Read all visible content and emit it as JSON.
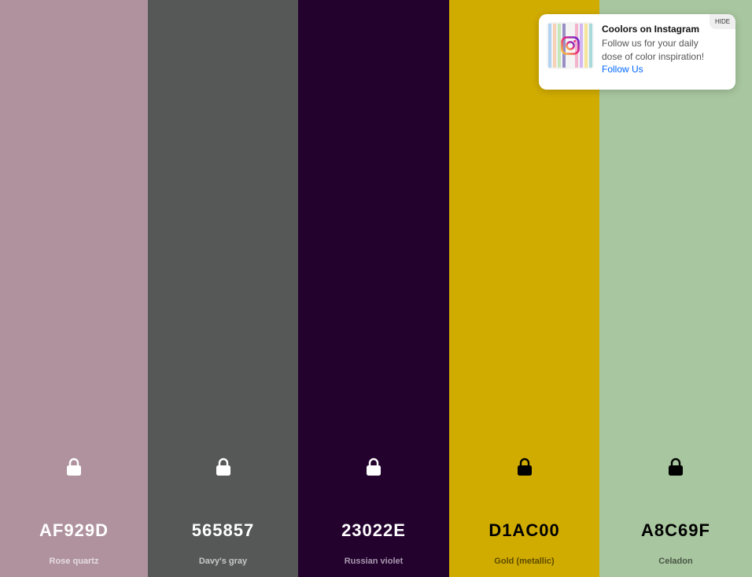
{
  "palette": {
    "colors": [
      {
        "hex": "AF929D",
        "name": "Rose quartz",
        "bg": "#AF929D",
        "text_color": "#FFFFFF",
        "name_color": "#E6DCE0",
        "lock_color": "#FFFFFF"
      },
      {
        "hex": "565857",
        "name": "Davy's gray",
        "bg": "#565857",
        "text_color": "#FFFFFF",
        "name_color": "#C7C8C8",
        "lock_color": "#FFFFFF"
      },
      {
        "hex": "23022E",
        "name": "Russian violet",
        "bg": "#23022E",
        "text_color": "#FFFFFF",
        "name_color": "#A89AAE",
        "lock_color": "#FFFFFF"
      },
      {
        "hex": "D1AC00",
        "name": "Gold (metallic)",
        "bg": "#D1AC00",
        "text_color": "#000000",
        "name_color": "#5C4B00",
        "lock_color": "#000000"
      },
      {
        "hex": "A8C69F",
        "name": "Celadon",
        "bg": "#A8C69F",
        "text_color": "#000000",
        "name_color": "#4A5746",
        "lock_color": "#000000"
      }
    ]
  },
  "promo": {
    "title": "Coolors on Instagram",
    "body": "Follow us for your daily dose of color inspiration!",
    "link": "Follow Us",
    "hide_label": "HIDE",
    "icons": {
      "logo": "instagram-icon",
      "lock": "lock-icon"
    },
    "thumb_colors": [
      "#9ec9f0",
      "#f7c6a3",
      "#b6e3a8",
      "#7a6fb3",
      "#f29fc0",
      "#c9a3f2",
      "#f5e07a",
      "#8fd3d1",
      "#2e2e5a",
      "#e87b6b"
    ]
  }
}
